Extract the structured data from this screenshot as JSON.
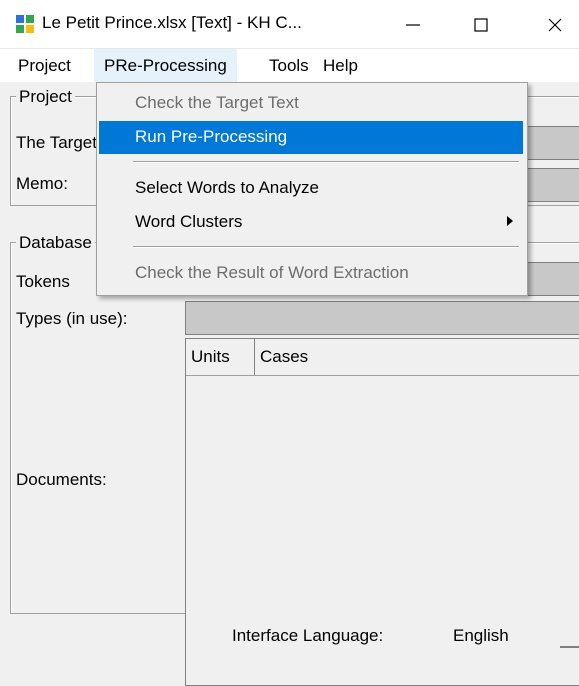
{
  "window": {
    "title": "Le Petit Prince.xlsx [Text] - KH C...",
    "minimize_glyph": "—",
    "maximize_glyph": "☐",
    "close_glyph": "✕"
  },
  "menubar": {
    "items": [
      {
        "label": "Project"
      },
      {
        "label": "PRe-Processing"
      },
      {
        "label": "Tools"
      },
      {
        "label": "Help"
      }
    ]
  },
  "dropdown": {
    "items": [
      {
        "label": "Check the Target Text",
        "enabled": false
      },
      {
        "label": "Run Pre-Processing",
        "enabled": true,
        "highlighted": true
      },
      {
        "label": "Select Words to Analyze",
        "enabled": true
      },
      {
        "label": "Word Clusters",
        "enabled": true,
        "submenu": true
      },
      {
        "label": "Check the Result of Word Extraction",
        "enabled": false
      }
    ]
  },
  "project_group": {
    "legend": "Project",
    "target_label": "The Target",
    "memo_label": "Memo:"
  },
  "database_group": {
    "legend": "Database",
    "tokens_label": "Tokens",
    "types_label": "Types (in use):",
    "documents_label": "Documents:",
    "columns": [
      "Units",
      "Cases"
    ]
  },
  "status": {
    "interface_language_label": "Interface Language:",
    "interface_language_value": "English"
  },
  "colors": {
    "accent": "#0078d7",
    "menu_open_bg": "#e5f1fb",
    "field_bg": "#c8c8c8",
    "window_bg": "#f0f0f0"
  },
  "icons": {
    "app": "kh-coder-grid-icon",
    "submenu": "chevron-right-icon"
  }
}
